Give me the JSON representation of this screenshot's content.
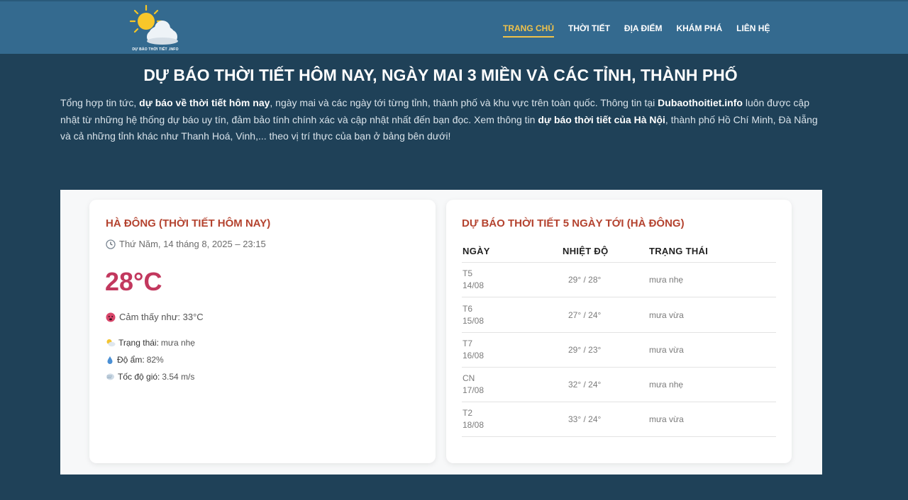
{
  "header": {
    "logo_text": "DỰ BÁO THỜI TIẾT .INFO",
    "nav": [
      "TRANG CHỦ",
      "THỜI TIẾT",
      "ĐỊA ĐIỂM",
      "KHÁM PHÁ",
      "LIÊN HỆ"
    ]
  },
  "page": {
    "title": "DỰ BÁO THỜI TIẾT HÔM NAY, NGÀY MAI 3 MIỀN VÀ CÁC TỈNH, THÀNH PHỐ",
    "intro": {
      "t1": "Tổng hợp tin tức, ",
      "b1": "dự báo về thời tiết hôm nay",
      "t2": ", ngày mai và các ngày tới từng tỉnh, thành phố và khu vực trên toàn quốc. Thông tin tại ",
      "b2": "Dubaothoitiet.info",
      "t3": " luôn được cập nhật từ những hệ thống dự báo uy tín, đảm bảo tính chính xác và cập nhật nhất đến bạn đọc. Xem thông tin ",
      "b3": "dự báo thời tiết của Hà Nội",
      "t4": ", thành phố Hồ Chí Minh, Đà Nẵng và cả những tỉnh khác như Thanh Hoá, Vinh,... theo vị trí thực của bạn ở bảng bên dưới!"
    }
  },
  "current": {
    "title": "HÀ ĐÔNG (THỜI TIẾT HÔM NAY)",
    "datetime": "Thứ Năm, 14 tháng 8, 2025 – 23:15",
    "temperature": "28°C",
    "feels_like": "Cảm thấy như: 33°C",
    "status_label": "Trạng thái:",
    "status_value": "mưa nhẹ",
    "humidity_label": "Độ ẩm:",
    "humidity_value": "82%",
    "wind_label": "Tốc độ gió:",
    "wind_value": "3.54 m/s"
  },
  "forecast": {
    "title": "DỰ BÁO THỜI TIẾT 5 NGÀY TỚI (HÀ ĐÔNG)",
    "columns": [
      "NGÀY",
      "NHIỆT ĐỘ",
      "TRẠNG THÁI"
    ],
    "rows": [
      {
        "day": "T5",
        "date": "14/08",
        "temp": "29° / 28°",
        "state": "mưa nhẹ"
      },
      {
        "day": "T6",
        "date": "15/08",
        "temp": "27° / 24°",
        "state": "mưa vừa"
      },
      {
        "day": "T7",
        "date": "16/08",
        "temp": "29° / 23°",
        "state": "mưa vừa"
      },
      {
        "day": "CN",
        "date": "17/08",
        "temp": "32° / 24°",
        "state": "mưa nhẹ"
      },
      {
        "day": "T2",
        "date": "18/08",
        "temp": "33° / 24°",
        "state": "mưa vừa"
      }
    ]
  },
  "colors": {
    "header_bg": "#346a8f",
    "page_bg": "#1f4158",
    "accent_nav": "#f0c24a",
    "card_title": "#b4432f",
    "temperature": "#c2385e"
  }
}
